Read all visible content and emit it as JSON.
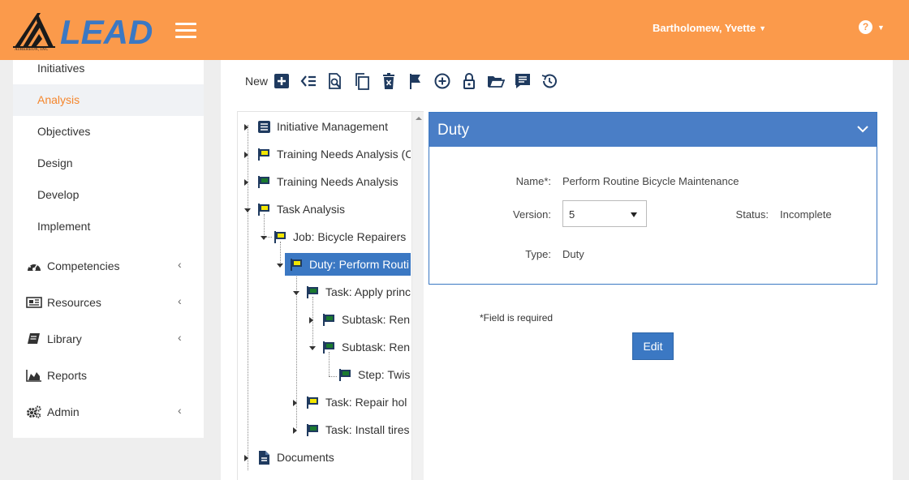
{
  "header": {
    "logo_text": "LEAD",
    "logo_company": "AIMEREON, INC",
    "user_name": "Bartholomew, Yvette",
    "help_symbol": "?",
    "brand_color": "#fb9a4b"
  },
  "sidebar": {
    "sub_items": [
      {
        "label": "Initiatives"
      },
      {
        "label": "Analysis",
        "active": true
      },
      {
        "label": "Objectives"
      },
      {
        "label": "Design"
      },
      {
        "label": "Develop"
      },
      {
        "label": "Implement"
      }
    ],
    "main_items": [
      {
        "label": "Competencies",
        "icon": "dashboard-icon",
        "chevron": "‹"
      },
      {
        "label": "Resources",
        "icon": "newspaper-icon",
        "chevron": "‹"
      },
      {
        "label": "Library",
        "icon": "book-icon",
        "chevron": "‹"
      },
      {
        "label": "Reports",
        "icon": "area-chart-icon"
      },
      {
        "label": "Admin",
        "icon": "gears-icon",
        "chevron": "‹"
      }
    ],
    "active_color": "#f5862c"
  },
  "toolbar": {
    "new_label": "New",
    "buttons": [
      "add-icon",
      "indent-list-icon",
      "search-document-icon",
      "copy-icon",
      "delete-icon",
      "flag-icon",
      "circle-plus-icon",
      "lock-icon",
      "folder-open-icon",
      "comment-list-icon",
      "history-icon"
    ]
  },
  "tree": {
    "nodes": [
      {
        "label": "Initiative Management",
        "icon": "list-document-icon"
      },
      {
        "label": "Training Needs Analysis (C",
        "icon": "yellow-flag-icon"
      },
      {
        "label": "Training Needs Analysis",
        "icon": "green-flag-icon"
      },
      {
        "label": "Task Analysis",
        "icon": "yellow-flag-icon"
      },
      {
        "label": "Job: Bicycle Repairers",
        "icon": "yellow-flag-icon"
      },
      {
        "label": "Duty: Perform Routi",
        "icon": "yellow-flag-icon",
        "selected": true
      },
      {
        "label": "Task: Apply princ",
        "icon": "green-flag-icon"
      },
      {
        "label": "Subtask: Ren",
        "icon": "green-flag-icon"
      },
      {
        "label": "Subtask: Ren",
        "icon": "green-flag-icon"
      },
      {
        "label": "Step: Twis",
        "icon": "green-flag-icon"
      },
      {
        "label": "Task: Repair hol",
        "icon": "yellow-flag-icon"
      },
      {
        "label": "Task: Install tires",
        "icon": "green-flag-icon"
      },
      {
        "label": "Documents",
        "icon": "document-icon"
      }
    ],
    "flag_yellow": "#f2e600",
    "flag_green": "#1a7a2e",
    "selected_color": "#3b78c3"
  },
  "detail": {
    "title": "Duty",
    "name_label": "Name*:",
    "name_value": "Perform Routine Bicycle Maintenance",
    "version_label": "Version:",
    "version_value": "5",
    "status_label": "Status:",
    "status_value": "Incomplete",
    "type_label": "Type:",
    "type_value": "Duty",
    "header_color": "#4a7ec6"
  },
  "footer": {
    "required_note": "*Field is required",
    "edit_label": "Edit"
  }
}
